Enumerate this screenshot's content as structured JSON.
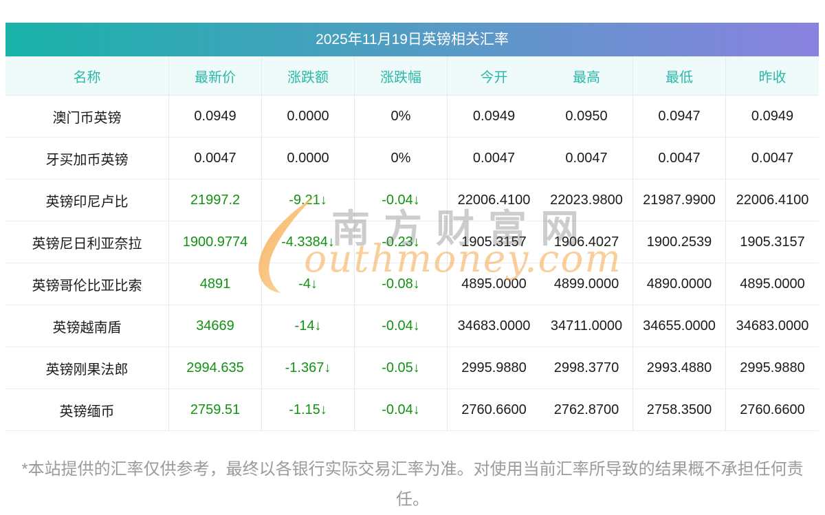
{
  "title": "2025年11月19日英镑相关汇率",
  "table": {
    "headers": [
      "名称",
      "最新价",
      "涨跌额",
      "涨跌幅",
      "今开",
      "最高",
      "最低",
      "昨收"
    ],
    "rows": [
      {
        "name": "澳门币英镑",
        "last": "0.0949",
        "change": "0.0000",
        "pct": "0%",
        "open": "0.0949",
        "high": "0.0950",
        "low": "0.0947",
        "prev": "0.0949",
        "trend": "flat"
      },
      {
        "name": "牙买加币英镑",
        "last": "0.0047",
        "change": "0.0000",
        "pct": "0%",
        "open": "0.0047",
        "high": "0.0047",
        "low": "0.0047",
        "prev": "0.0047",
        "trend": "flat"
      },
      {
        "name": "英镑印尼卢比",
        "last": "21997.2",
        "change": "-9.21↓",
        "pct": "-0.04↓",
        "open": "22006.4100",
        "high": "22023.9800",
        "low": "21987.9900",
        "prev": "22006.4100",
        "trend": "down"
      },
      {
        "name": "英镑尼日利亚奈拉",
        "last": "1900.9774",
        "change": "-4.3384↓",
        "pct": "-0.23↓",
        "open": "1905.3157",
        "high": "1906.4027",
        "low": "1900.2539",
        "prev": "1905.3157",
        "trend": "down"
      },
      {
        "name": "英镑哥伦比亚比索",
        "last": "4891",
        "change": "-4↓",
        "pct": "-0.08↓",
        "open": "4895.0000",
        "high": "4899.0000",
        "low": "4890.0000",
        "prev": "4895.0000",
        "trend": "down"
      },
      {
        "name": "英镑越南盾",
        "last": "34669",
        "change": "-14↓",
        "pct": "-0.04↓",
        "open": "34683.0000",
        "high": "34711.0000",
        "low": "34655.0000",
        "prev": "34683.0000",
        "trend": "down"
      },
      {
        "name": "英镑刚果法郎",
        "last": "2994.635",
        "change": "-1.367↓",
        "pct": "-0.05↓",
        "open": "2995.9880",
        "high": "2998.3770",
        "low": "2993.4880",
        "prev": "2995.9880",
        "trend": "down"
      },
      {
        "name": "英镑缅币",
        "last": "2759.51",
        "change": "-1.15↓",
        "pct": "-0.04↓",
        "open": "2760.6600",
        "high": "2762.8700",
        "low": "2758.3500",
        "prev": "2760.6600",
        "trend": "down"
      }
    ]
  },
  "watermark": {
    "cn": "南方财富网",
    "en": "outhmoney.com"
  },
  "disclaimer": "*本站提供的汇率仅供参考，最终以各银行实际交易汇率为准。对使用当前汇率所导致的结果概不承担任何责任。",
  "colors": {
    "gradient_start": "#18b2a8",
    "gradient_end": "#8b82e0",
    "header_text": "#2bb8a8",
    "header_bg": "#effbfa",
    "down_green": "#119312"
  }
}
